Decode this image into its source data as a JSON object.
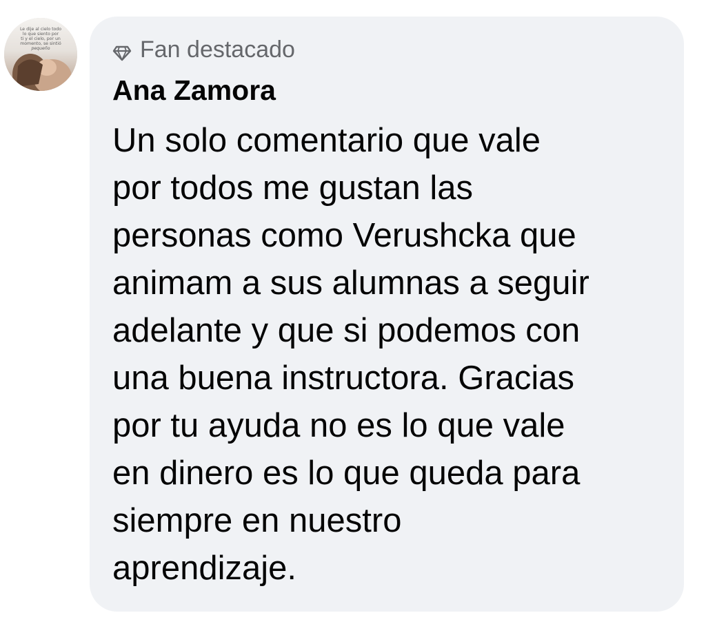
{
  "avatar": {
    "alt": "profile picture",
    "caption_lines": [
      "Le dije al cielo todo",
      "lo que siento por",
      "ti y el cielo, por un",
      "momento, se sintió",
      "pequeño"
    ]
  },
  "comment": {
    "badge_icon": "diamond-icon",
    "badge_label": "Fan destacado",
    "author": "Ana Zamora",
    "text": "Un solo comentario que vale\npor todos me gustan las\npersonas como Verushcka que\nanimam a sus alumnas a seguir\nadelante y que si podemos con\nuna buena instructora. Gracias\npor tu ayuda no es lo que vale\nen dinero es lo que queda para\nsiempre en nuestro\naprendizaje."
  },
  "colors": {
    "bubble_background": "#f0f2f5",
    "secondary_text": "#65676b",
    "primary_text": "#050505"
  }
}
